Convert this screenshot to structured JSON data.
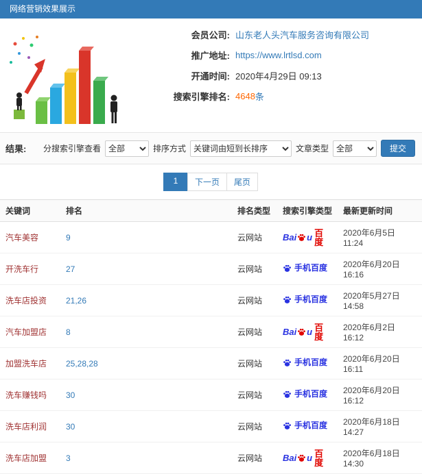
{
  "header": {
    "title": "网络营销效果展示"
  },
  "info": {
    "fields": [
      {
        "label": "会员公司:",
        "value": "山东老人头汽车服务咨询有限公司"
      },
      {
        "label": "推广地址:",
        "value": "https://www.lrtlsd.com"
      },
      {
        "label": "开通时间:",
        "value": "2020年4月29日 09:13"
      },
      {
        "label": "搜索引擎排名:",
        "value": "4648",
        "suffix": "条"
      }
    ]
  },
  "filters": {
    "section_label": "结果:",
    "engine_label": "分搜索引擎查看",
    "engine_value": "全部",
    "sort_label": "排序方式",
    "sort_value": "关键词由短到长排序",
    "article_label": "文章类型",
    "article_value": "全部",
    "submit_label": "提交"
  },
  "pagination": {
    "current": "1",
    "next": "下一页",
    "last": "尾页"
  },
  "logos": {
    "baidu_latin": "Bai",
    "baidu_latin2": "u",
    "baidu_cn": "百度",
    "mobile": "手机百度"
  },
  "table": {
    "headers": [
      "关键词",
      "排名",
      "排名类型",
      "搜索引擎类型",
      "最新更新时间"
    ],
    "rows": [
      {
        "keyword": "汽车美容",
        "rank": "9",
        "rank_type": "云网站",
        "engine": "百度",
        "engine_kind": "baidu",
        "time": "2020年6月5日 11:24"
      },
      {
        "keyword": "开洗车行",
        "rank": "27",
        "rank_type": "云网站",
        "engine": "手机百度",
        "engine_kind": "mobile",
        "time": "2020年6月20日 16:16"
      },
      {
        "keyword": "洗车店投资",
        "rank": "21,26",
        "rank_type": "云网站",
        "engine": "手机百度",
        "engine_kind": "mobile",
        "time": "2020年5月27日 14:58"
      },
      {
        "keyword": "汽车加盟店",
        "rank": "8",
        "rank_type": "云网站",
        "engine": "百度",
        "engine_kind": "baidu",
        "time": "2020年6月2日 16:12"
      },
      {
        "keyword": "加盟洗车店",
        "rank": "25,28,28",
        "rank_type": "云网站",
        "engine": "手机百度",
        "engine_kind": "mobile",
        "time": "2020年6月20日 16:11"
      },
      {
        "keyword": "洗车赚钱吗",
        "rank": "30",
        "rank_type": "云网站",
        "engine": "手机百度",
        "engine_kind": "mobile",
        "time": "2020年6月20日 16:12"
      },
      {
        "keyword": "洗车店利润",
        "rank": "30",
        "rank_type": "云网站",
        "engine": "手机百度",
        "engine_kind": "mobile",
        "time": "2020年6月18日 14:27"
      },
      {
        "keyword": "洗车店加盟",
        "rank": "3",
        "rank_type": "云网站",
        "engine": "百度",
        "engine_kind": "baidu",
        "time": "2020年6月18日 14:30"
      }
    ]
  },
  "colors": {
    "accent": "#337ab7",
    "highlight": "#ff6600",
    "keyword_red": "#a03333",
    "baidu_blue": "#2932e1",
    "baidu_red": "#e10601"
  }
}
